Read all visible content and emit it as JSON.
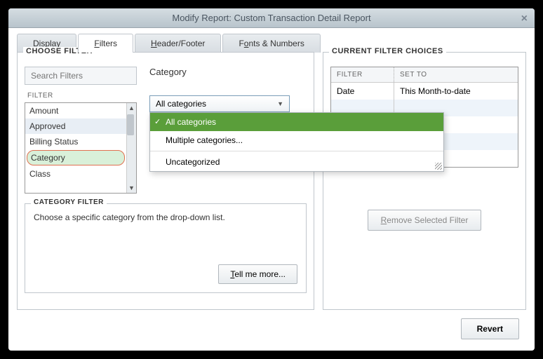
{
  "title": "Modify Report: Custom Transaction Detail Report",
  "tabs": {
    "display": "Display",
    "filters": "Filters",
    "header": "Header/Footer",
    "fonts": "Fonts & Numbers"
  },
  "choose_filter_label": "CHOOSE FILTER",
  "search_placeholder": "Search Filters",
  "filter_col": "FILTER",
  "filters_list": [
    "Amount",
    "Approved",
    "Billing Status",
    "Category",
    "Class"
  ],
  "category_label": "Category",
  "dropdown_value": "All categories",
  "dropdown_items": [
    "All categories",
    "Multiple categories...",
    "Uncategorized"
  ],
  "cat_filter_title": "CATEGORY FILTER",
  "cat_filter_text": "Choose a specific category from the drop-down list.",
  "tell_me_more": "Tell me more...",
  "current_choices_label": "CURRENT FILTER CHOICES",
  "choices_head_filter": "FILTER",
  "choices_head_setto": "SET TO",
  "choices": [
    {
      "filter": "Date",
      "setto": "This Month-to-date"
    }
  ],
  "remove_label": "Remove Selected Filter",
  "revert_label": "Revert"
}
